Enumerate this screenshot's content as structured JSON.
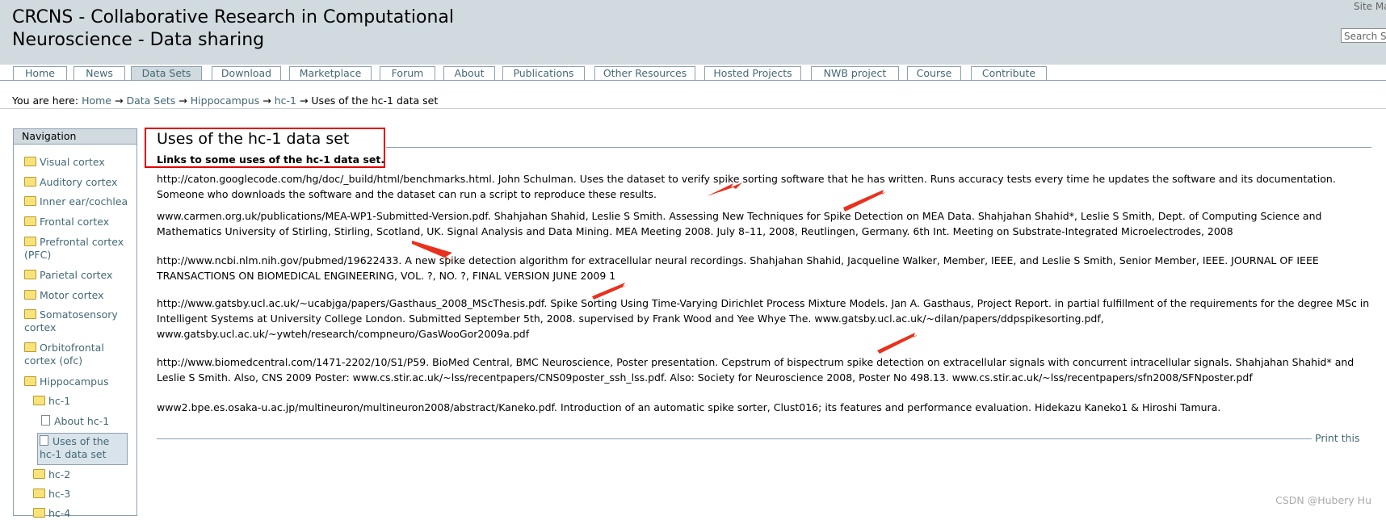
{
  "header": {
    "title_line1": "CRCNS - Collaborative Research in Computational",
    "title_line2": "Neuroscience - Data sharing",
    "site_map": "Site Map",
    "search_placeholder": "Search Site"
  },
  "tabs": [
    {
      "label": "Home"
    },
    {
      "label": "News"
    },
    {
      "label": "Data Sets",
      "selected": true
    },
    {
      "label": "Download"
    },
    {
      "label": "Marketplace"
    },
    {
      "label": "Forum"
    },
    {
      "label": "About"
    },
    {
      "label": "Publications"
    },
    {
      "label": "Other Resources"
    },
    {
      "label": "Hosted Projects"
    },
    {
      "label": "NWB project"
    },
    {
      "label": "Course"
    },
    {
      "label": "Contribute"
    }
  ],
  "breadcrumb": {
    "prefix": "You are here:",
    "items": [
      "Home",
      "Data Sets",
      "Hippocampus",
      "hc-1"
    ],
    "current": "Uses of the hc-1 data set",
    "separator": "→"
  },
  "navigation": {
    "heading": "Navigation",
    "items": [
      {
        "label": "Visual cortex",
        "icon": "folder-icon"
      },
      {
        "label": "Auditory cortex",
        "icon": "folder-icon"
      },
      {
        "label": "Inner ear/cochlea",
        "icon": "folder-icon"
      },
      {
        "label": "Frontal cortex",
        "icon": "folder-icon"
      },
      {
        "label": "Prefrontal cortex (PFC)",
        "icon": "folder-icon"
      },
      {
        "label": "Parietal cortex",
        "icon": "folder-icon"
      },
      {
        "label": "Motor cortex",
        "icon": "folder-icon"
      },
      {
        "label": "Somatosensory cortex",
        "icon": "folder-icon"
      },
      {
        "label": "Orbitofrontal cortex (ofc)",
        "icon": "folder-icon"
      },
      {
        "label": "Hippocampus",
        "icon": "folder-icon"
      },
      {
        "label": "hc-1",
        "icon": "folder-icon"
      },
      {
        "label": "About hc-1",
        "icon": "document-icon"
      },
      {
        "label": "Uses of the hc-1 data set",
        "icon": "document-icon"
      },
      {
        "label": "hc-2",
        "icon": "folder-icon"
      },
      {
        "label": "hc-3",
        "icon": "folder-icon"
      },
      {
        "label": "hc-4",
        "icon": "folder-icon"
      }
    ]
  },
  "content": {
    "title": "Uses of the hc-1 data set",
    "description": "Links to some uses of the hc-1 data set.",
    "paragraphs": [
      "http://caton.googlecode.com/hg/doc/_build/html/benchmarks.html.  John Schulman.  Uses the dataset to verify spike sorting software that he has written. Runs accuracy tests every time he updates the software and its documentation. Someone who downloads the software and the dataset can run a script to reproduce these results.",
      "www.carmen.org.uk/publications/MEA-WP1-Submitted-Version.pdf.  Shahjahan Shahid, Leslie S Smith.  Assessing New Techniques for Spike Detection on MEA Data. Shahjahan Shahid*, Leslie S Smith, Dept. of Computing Science and Mathematics University of Stirling, Stirling, Scotland, UK.  Signal Analysis and Data Mining.  MEA Meeting 2008.  July 8–11, 2008, Reutlingen, Germany. 6th Int. Meeting on Substrate-Integrated Microelectrodes, 2008",
      "http://www.ncbi.nlm.nih.gov/pubmed/19622433. A new spike detection algorithm for extracellular neural recordings. Shahjahan Shahid, Jacqueline Walker, Member, IEEE, and Leslie S Smith, Senior Member, IEEE.  JOURNAL OF IEEE TRANSACTIONS ON BIOMEDICAL ENGINEERING, VOL. ?, NO. ?, FINAL VERSION JUNE 2009 1",
      "http://www.gatsby.ucl.ac.uk/~ucabjga/papers/Gasthaus_2008_MScThesis.pdf.  Spike Sorting Using Time-Varying Dirichlet Process Mixture Models. Jan A. Gasthaus, Project Report. in partial fulfillment of the requirements for the degree MSc in Intelligent Systems at University College London.  Submitted September 5th, 2008. supervised by Frank Wood and Yee Whye The. www.gatsby.ucl.ac.uk/~dilan/papers/ddpspikesorting.pdf, www.gatsby.ucl.ac.uk/~ywteh/research/compneuro/GasWooGor2009a.pdf",
      "http://www.biomedcentral.com/1471-2202/10/S1/P59. BioMed Central, BMC Neuroscience, Poster presentation. Cepstrum of bispectrum spike detection on extracellular signals with concurrent intracellular signals. Shahjahan Shahid* and Leslie S Smith. Also, CNS 2009 Poster: www.cs.stir.ac.uk/~lss/recentpapers/CNS09poster_ssh_lss.pdf.  Also: Society for Neuroscience 2008, Poster No 498.13. www.cs.stir.ac.uk/~lss/recentpapers/sfn2008/SFNposter.pdf",
      "www2.bpe.es.osaka-u.ac.jp/multineuron/multineuron2008/abstract/Kaneko.pdf.  Introduction of an automatic spike sorter, Clust016; its features and performance evaluation.  Hidekazu Kaneko1 & Hiroshi Tamura."
    ],
    "print_link": "Print this"
  },
  "watermark": "CSDN @Hubery Hu",
  "colors": {
    "header_bg": "#d1dadf",
    "link": "#436976",
    "annotation": "#e00000"
  }
}
